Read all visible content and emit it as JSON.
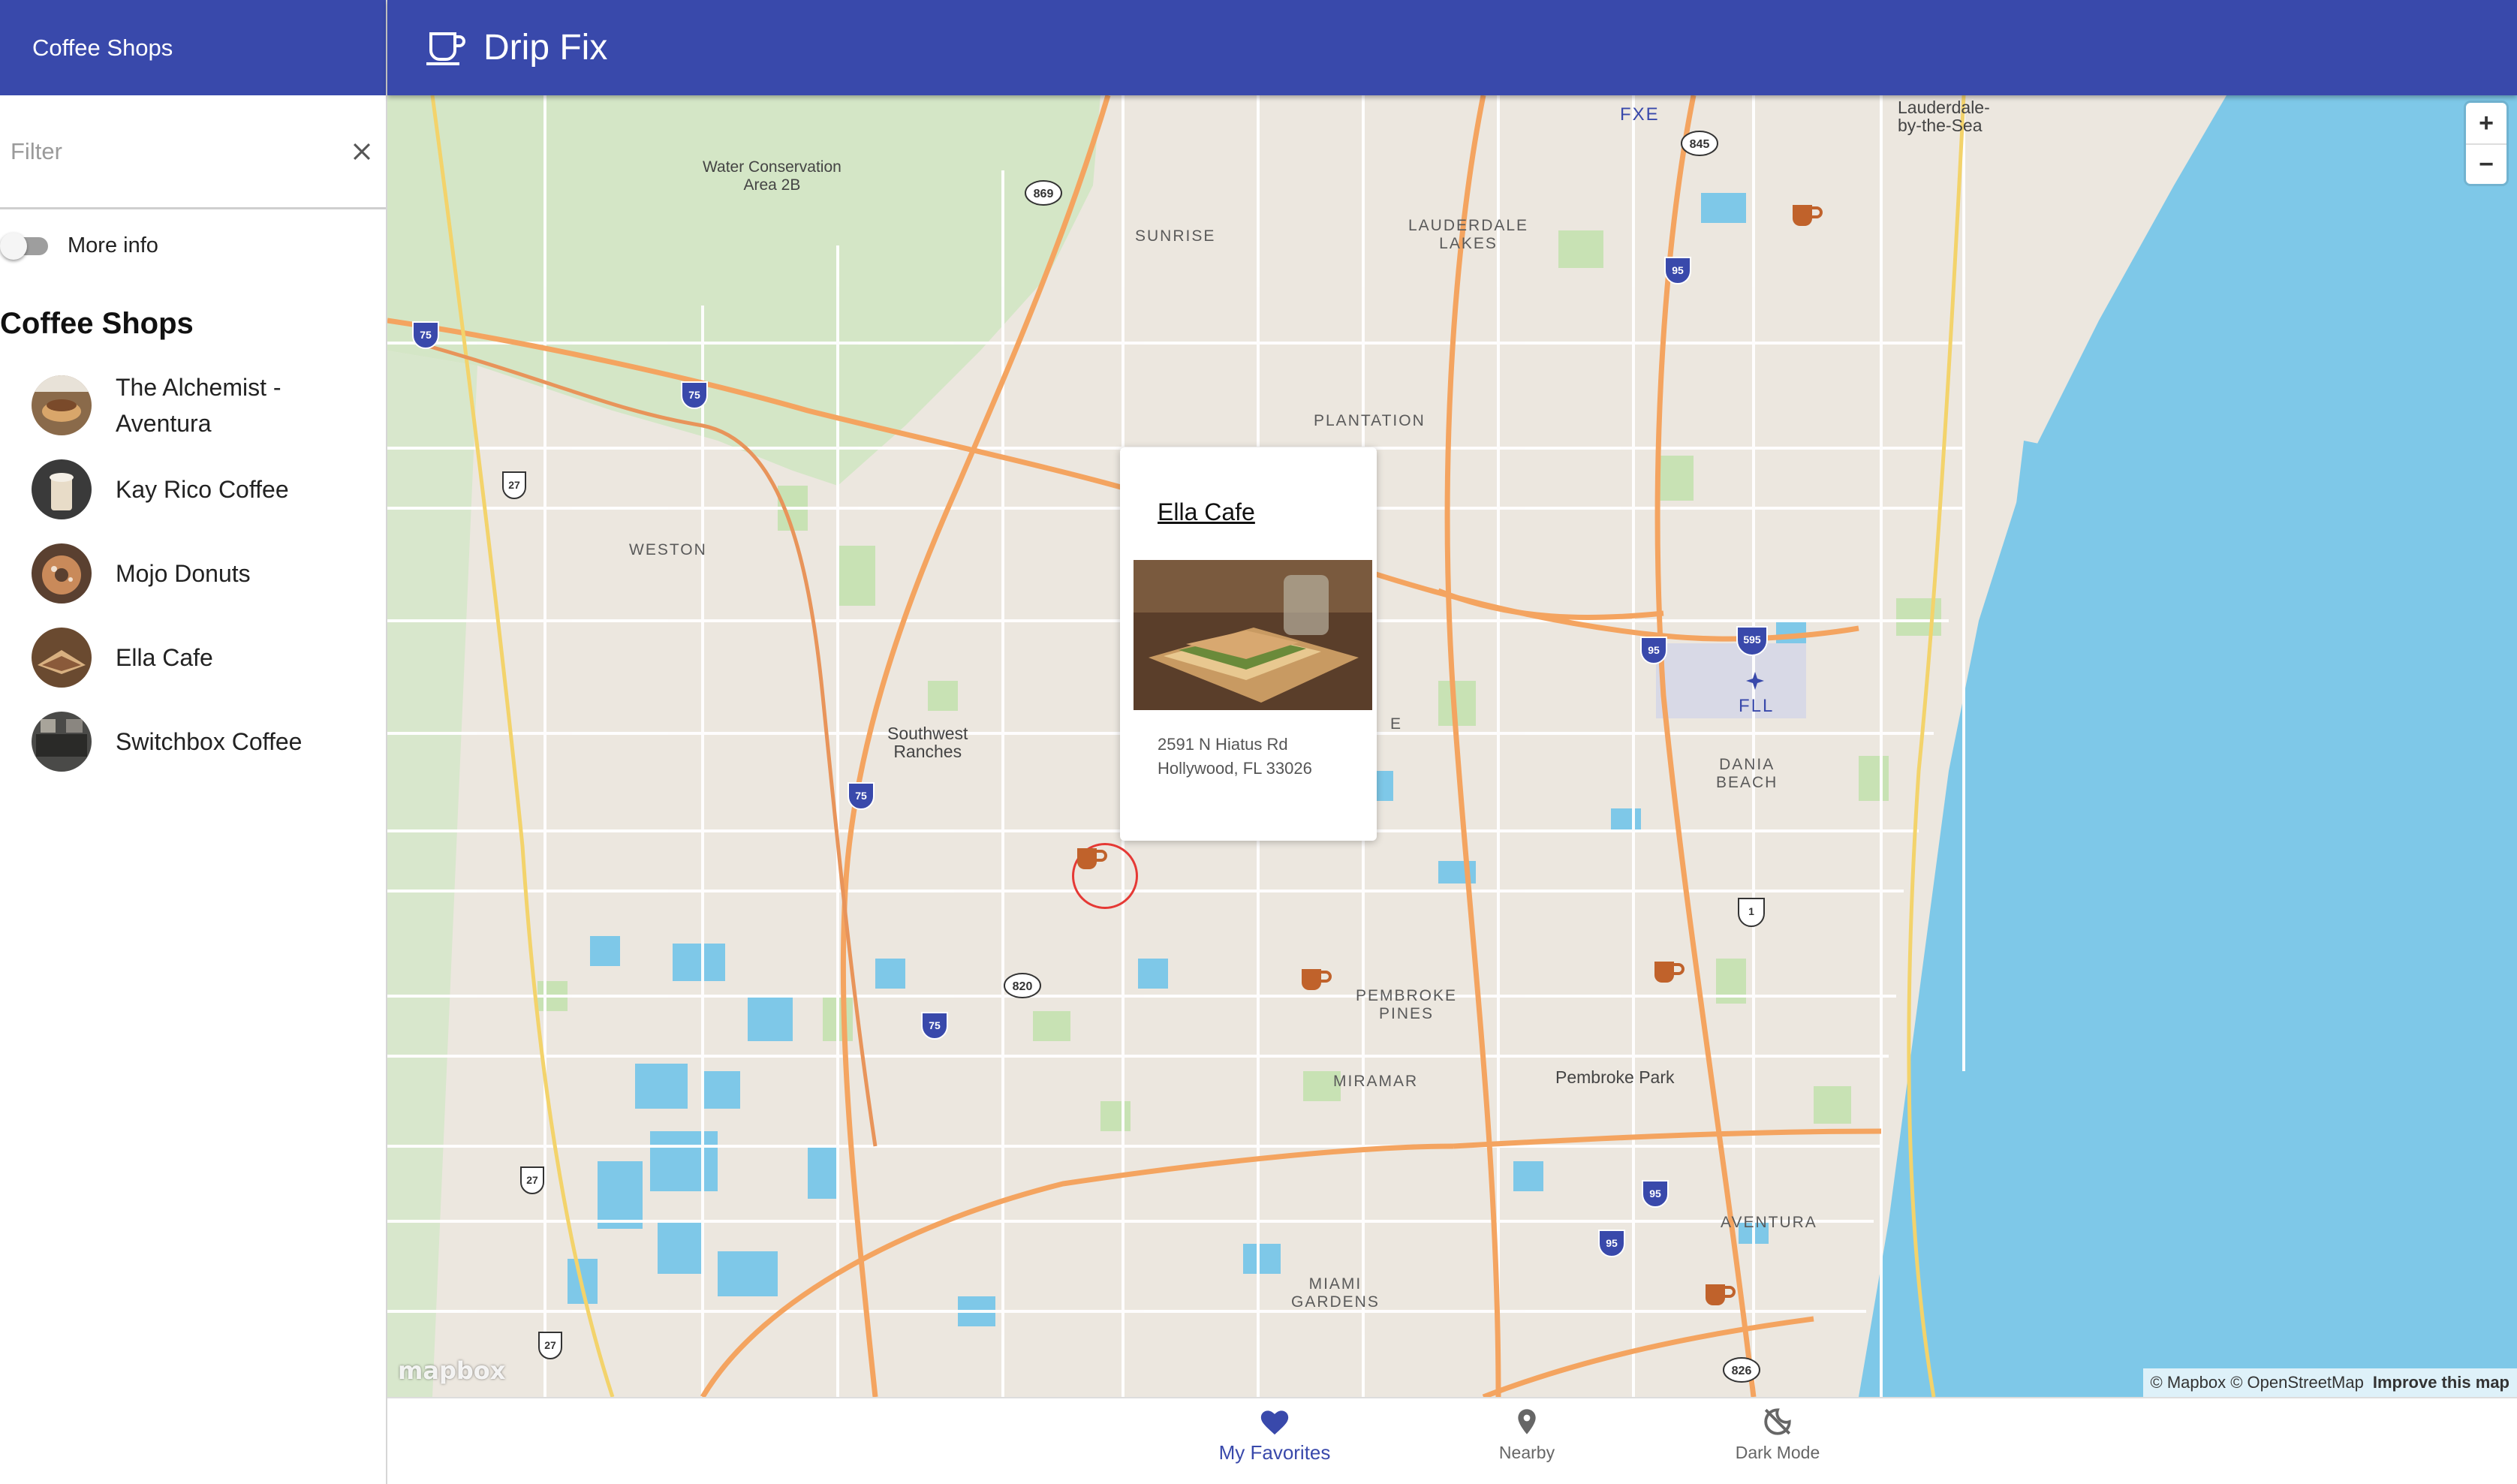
{
  "sidebar": {
    "header_title": "Coffee Shops",
    "filter": {
      "placeholder": "Filter",
      "value": ""
    },
    "toggle_label": "More info",
    "list_title": "Coffee Shops",
    "items": [
      {
        "name": "The Alchemist - Aventura"
      },
      {
        "name": "Kay Rico Coffee"
      },
      {
        "name": "Mojo Donuts"
      },
      {
        "name": "Ella Cafe"
      },
      {
        "name": "Switchbox Coffee"
      }
    ]
  },
  "topbar": {
    "title": "Drip Fix",
    "icon": "coffee-cup-icon"
  },
  "map": {
    "zoom_in": "+",
    "zoom_out": "−",
    "popup": {
      "title": "Ella Cafe",
      "address_line1": "2591 N Hiatus Rd",
      "address_line2": "Hollywood, FL 33026"
    },
    "labels": {
      "water_conservation": "Water Conservation",
      "area_2b": "Area 2B",
      "sunrise": "SUNRISE",
      "lauderdale_lakes_1": "LAUDERDALE",
      "lauderdale_lakes_2": "LAKES",
      "plantation": "PLANTATION",
      "weston": "WESTON",
      "southwest_1": "Southwest",
      "southwest_2": "Ranches",
      "dania_1": "DANIA",
      "dania_2": "BEACH",
      "pembroke_pines_1": "PEMBROKE",
      "pembroke_pines_2": "PINES",
      "miramar": "MIRAMAR",
      "pembroke_park": "Pembroke Park",
      "miami_gardens_1": "MIAMI",
      "miami_gardens_2": "GARDENS",
      "aventura": "AVENTURA",
      "lauderdale_sea_1": "Lauderdale-",
      "lauderdale_sea_2": "by-the-Sea",
      "fxe": "FXE",
      "fll": "FLL",
      "e_fragment": "E"
    },
    "shields": [
      "869",
      "845",
      "95",
      "75",
      "75",
      "27",
      "595",
      "95",
      "75",
      "1",
      "820",
      "75",
      "27",
      "95",
      "95",
      "27",
      "826"
    ],
    "attribution": "© Mapbox © OpenStreetMap",
    "improve": "Improve this map",
    "logo": "mapbox"
  },
  "bottomnav": {
    "items": [
      {
        "label": "My Favorites",
        "icon": "heart-icon",
        "active": true
      },
      {
        "label": "Nearby",
        "icon": "location-pin-icon",
        "active": false
      },
      {
        "label": "Dark Mode",
        "icon": "dark-mode-off-icon",
        "active": false
      }
    ]
  },
  "colors": {
    "primary": "#3949ab",
    "water": "#7ec8e8",
    "major_road": "#f4a460",
    "coffee_marker": "#c0622b",
    "selected_ring": "#e53935"
  }
}
